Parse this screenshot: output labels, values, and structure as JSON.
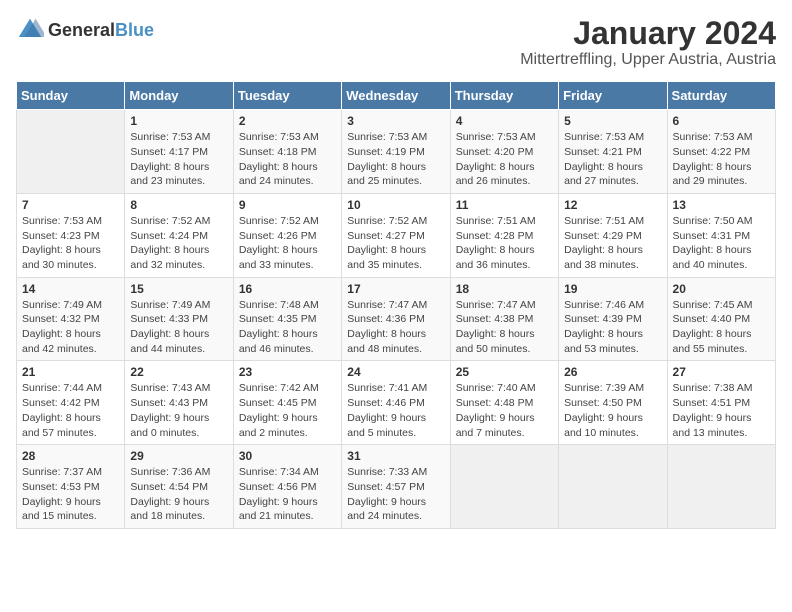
{
  "logo": {
    "general": "General",
    "blue": "Blue"
  },
  "title": "January 2024",
  "subtitle": "Mittertreffling, Upper Austria, Austria",
  "weekdays": [
    "Sunday",
    "Monday",
    "Tuesday",
    "Wednesday",
    "Thursday",
    "Friday",
    "Saturday"
  ],
  "weeks": [
    [
      {
        "day": "",
        "sunrise": "",
        "sunset": "",
        "daylight": ""
      },
      {
        "day": "1",
        "sunrise": "Sunrise: 7:53 AM",
        "sunset": "Sunset: 4:17 PM",
        "daylight": "Daylight: 8 hours and 23 minutes."
      },
      {
        "day": "2",
        "sunrise": "Sunrise: 7:53 AM",
        "sunset": "Sunset: 4:18 PM",
        "daylight": "Daylight: 8 hours and 24 minutes."
      },
      {
        "day": "3",
        "sunrise": "Sunrise: 7:53 AM",
        "sunset": "Sunset: 4:19 PM",
        "daylight": "Daylight: 8 hours and 25 minutes."
      },
      {
        "day": "4",
        "sunrise": "Sunrise: 7:53 AM",
        "sunset": "Sunset: 4:20 PM",
        "daylight": "Daylight: 8 hours and 26 minutes."
      },
      {
        "day": "5",
        "sunrise": "Sunrise: 7:53 AM",
        "sunset": "Sunset: 4:21 PM",
        "daylight": "Daylight: 8 hours and 27 minutes."
      },
      {
        "day": "6",
        "sunrise": "Sunrise: 7:53 AM",
        "sunset": "Sunset: 4:22 PM",
        "daylight": "Daylight: 8 hours and 29 minutes."
      }
    ],
    [
      {
        "day": "7",
        "sunrise": "Sunrise: 7:53 AM",
        "sunset": "Sunset: 4:23 PM",
        "daylight": "Daylight: 8 hours and 30 minutes."
      },
      {
        "day": "8",
        "sunrise": "Sunrise: 7:52 AM",
        "sunset": "Sunset: 4:24 PM",
        "daylight": "Daylight: 8 hours and 32 minutes."
      },
      {
        "day": "9",
        "sunrise": "Sunrise: 7:52 AM",
        "sunset": "Sunset: 4:26 PM",
        "daylight": "Daylight: 8 hours and 33 minutes."
      },
      {
        "day": "10",
        "sunrise": "Sunrise: 7:52 AM",
        "sunset": "Sunset: 4:27 PM",
        "daylight": "Daylight: 8 hours and 35 minutes."
      },
      {
        "day": "11",
        "sunrise": "Sunrise: 7:51 AM",
        "sunset": "Sunset: 4:28 PM",
        "daylight": "Daylight: 8 hours and 36 minutes."
      },
      {
        "day": "12",
        "sunrise": "Sunrise: 7:51 AM",
        "sunset": "Sunset: 4:29 PM",
        "daylight": "Daylight: 8 hours and 38 minutes."
      },
      {
        "day": "13",
        "sunrise": "Sunrise: 7:50 AM",
        "sunset": "Sunset: 4:31 PM",
        "daylight": "Daylight: 8 hours and 40 minutes."
      }
    ],
    [
      {
        "day": "14",
        "sunrise": "Sunrise: 7:49 AM",
        "sunset": "Sunset: 4:32 PM",
        "daylight": "Daylight: 8 hours and 42 minutes."
      },
      {
        "day": "15",
        "sunrise": "Sunrise: 7:49 AM",
        "sunset": "Sunset: 4:33 PM",
        "daylight": "Daylight: 8 hours and 44 minutes."
      },
      {
        "day": "16",
        "sunrise": "Sunrise: 7:48 AM",
        "sunset": "Sunset: 4:35 PM",
        "daylight": "Daylight: 8 hours and 46 minutes."
      },
      {
        "day": "17",
        "sunrise": "Sunrise: 7:47 AM",
        "sunset": "Sunset: 4:36 PM",
        "daylight": "Daylight: 8 hours and 48 minutes."
      },
      {
        "day": "18",
        "sunrise": "Sunrise: 7:47 AM",
        "sunset": "Sunset: 4:38 PM",
        "daylight": "Daylight: 8 hours and 50 minutes."
      },
      {
        "day": "19",
        "sunrise": "Sunrise: 7:46 AM",
        "sunset": "Sunset: 4:39 PM",
        "daylight": "Daylight: 8 hours and 53 minutes."
      },
      {
        "day": "20",
        "sunrise": "Sunrise: 7:45 AM",
        "sunset": "Sunset: 4:40 PM",
        "daylight": "Daylight: 8 hours and 55 minutes."
      }
    ],
    [
      {
        "day": "21",
        "sunrise": "Sunrise: 7:44 AM",
        "sunset": "Sunset: 4:42 PM",
        "daylight": "Daylight: 8 hours and 57 minutes."
      },
      {
        "day": "22",
        "sunrise": "Sunrise: 7:43 AM",
        "sunset": "Sunset: 4:43 PM",
        "daylight": "Daylight: 9 hours and 0 minutes."
      },
      {
        "day": "23",
        "sunrise": "Sunrise: 7:42 AM",
        "sunset": "Sunset: 4:45 PM",
        "daylight": "Daylight: 9 hours and 2 minutes."
      },
      {
        "day": "24",
        "sunrise": "Sunrise: 7:41 AM",
        "sunset": "Sunset: 4:46 PM",
        "daylight": "Daylight: 9 hours and 5 minutes."
      },
      {
        "day": "25",
        "sunrise": "Sunrise: 7:40 AM",
        "sunset": "Sunset: 4:48 PM",
        "daylight": "Daylight: 9 hours and 7 minutes."
      },
      {
        "day": "26",
        "sunrise": "Sunrise: 7:39 AM",
        "sunset": "Sunset: 4:50 PM",
        "daylight": "Daylight: 9 hours and 10 minutes."
      },
      {
        "day": "27",
        "sunrise": "Sunrise: 7:38 AM",
        "sunset": "Sunset: 4:51 PM",
        "daylight": "Daylight: 9 hours and 13 minutes."
      }
    ],
    [
      {
        "day": "28",
        "sunrise": "Sunrise: 7:37 AM",
        "sunset": "Sunset: 4:53 PM",
        "daylight": "Daylight: 9 hours and 15 minutes."
      },
      {
        "day": "29",
        "sunrise": "Sunrise: 7:36 AM",
        "sunset": "Sunset: 4:54 PM",
        "daylight": "Daylight: 9 hours and 18 minutes."
      },
      {
        "day": "30",
        "sunrise": "Sunrise: 7:34 AM",
        "sunset": "Sunset: 4:56 PM",
        "daylight": "Daylight: 9 hours and 21 minutes."
      },
      {
        "day": "31",
        "sunrise": "Sunrise: 7:33 AM",
        "sunset": "Sunset: 4:57 PM",
        "daylight": "Daylight: 9 hours and 24 minutes."
      },
      {
        "day": "",
        "sunrise": "",
        "sunset": "",
        "daylight": ""
      },
      {
        "day": "",
        "sunrise": "",
        "sunset": "",
        "daylight": ""
      },
      {
        "day": "",
        "sunrise": "",
        "sunset": "",
        "daylight": ""
      }
    ]
  ]
}
